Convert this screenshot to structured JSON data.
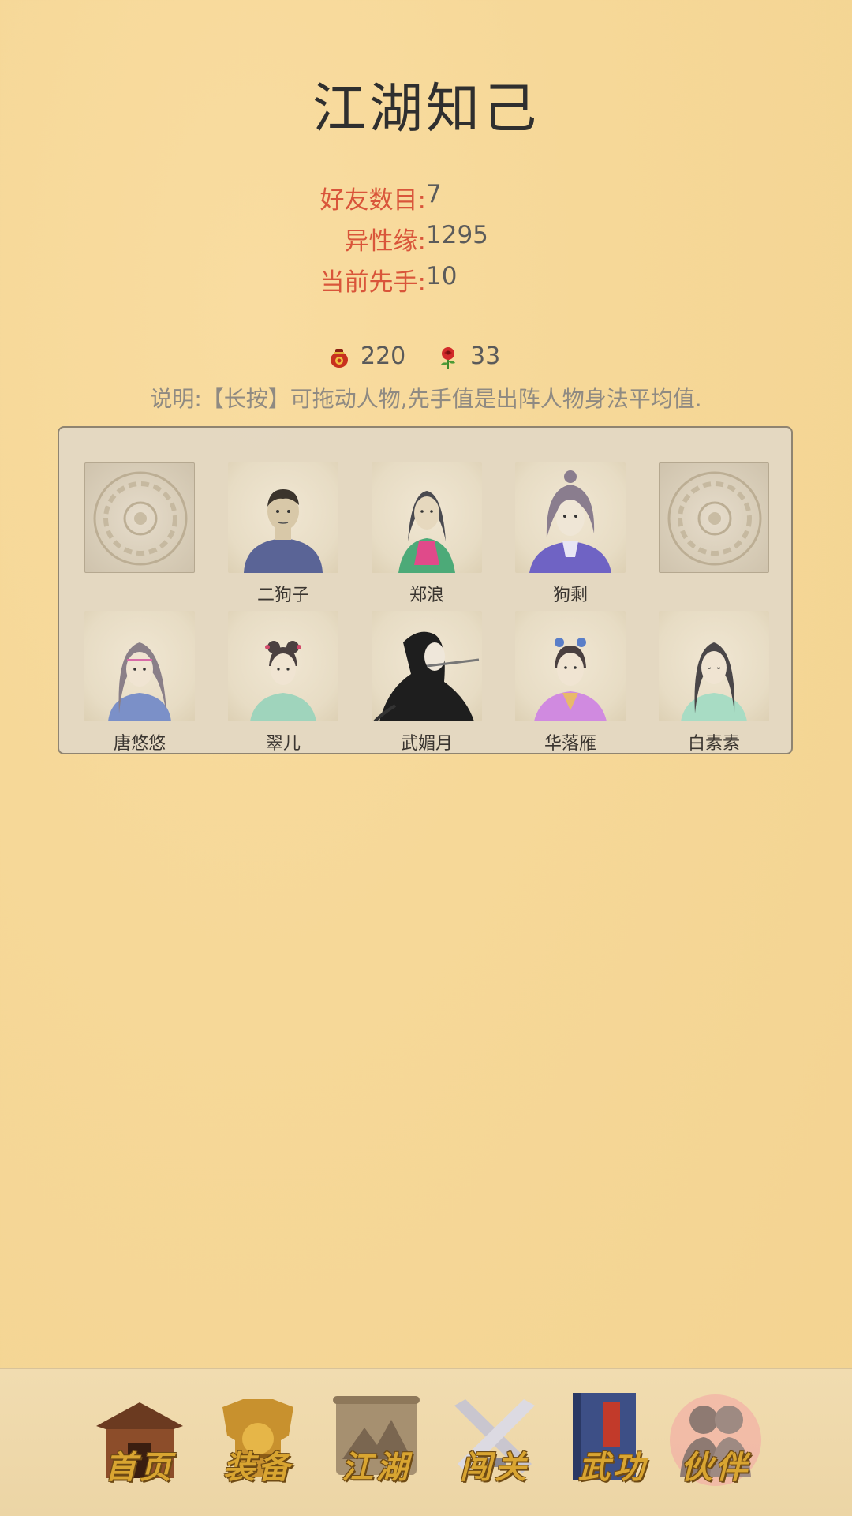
{
  "title": "江湖知己",
  "stats": [
    {
      "label": "好友数目:",
      "value": "7"
    },
    {
      "label": "异性缘:",
      "value": "1295"
    },
    {
      "label": "当前先手:",
      "value": "10"
    }
  ],
  "resources": [
    {
      "icon": "wine-jar-icon",
      "value": "220"
    },
    {
      "icon": "rose-icon",
      "value": "33"
    }
  ],
  "note": "说明:【长按】可拖动人物,先手值是出阵人物身法平均值.",
  "lineup": [
    {
      "name": "",
      "empty": true
    },
    {
      "name": "二狗子",
      "empty": false
    },
    {
      "name": "郑浪",
      "empty": false
    },
    {
      "name": "狗剩",
      "empty": false
    },
    {
      "name": "",
      "empty": true
    }
  ],
  "friends": [
    {
      "name": "唐悠悠"
    },
    {
      "name": "翠儿"
    },
    {
      "name": "武媚月"
    },
    {
      "name": "华落雁"
    },
    {
      "name": "白素素"
    }
  ],
  "nav": [
    {
      "label": "首页",
      "icon": "house-icon"
    },
    {
      "label": "装备",
      "icon": "armor-icon"
    },
    {
      "label": "江湖",
      "icon": "scroll-map-icon"
    },
    {
      "label": "闯关",
      "icon": "crossed-swords-icon"
    },
    {
      "label": "武功",
      "icon": "book-icon"
    },
    {
      "label": "伙伴",
      "icon": "partners-icon",
      "active": true
    }
  ],
  "colors": {
    "accent_red": "#d9553a",
    "nav_gold": "#d9a531",
    "background": "#f6d898"
  }
}
